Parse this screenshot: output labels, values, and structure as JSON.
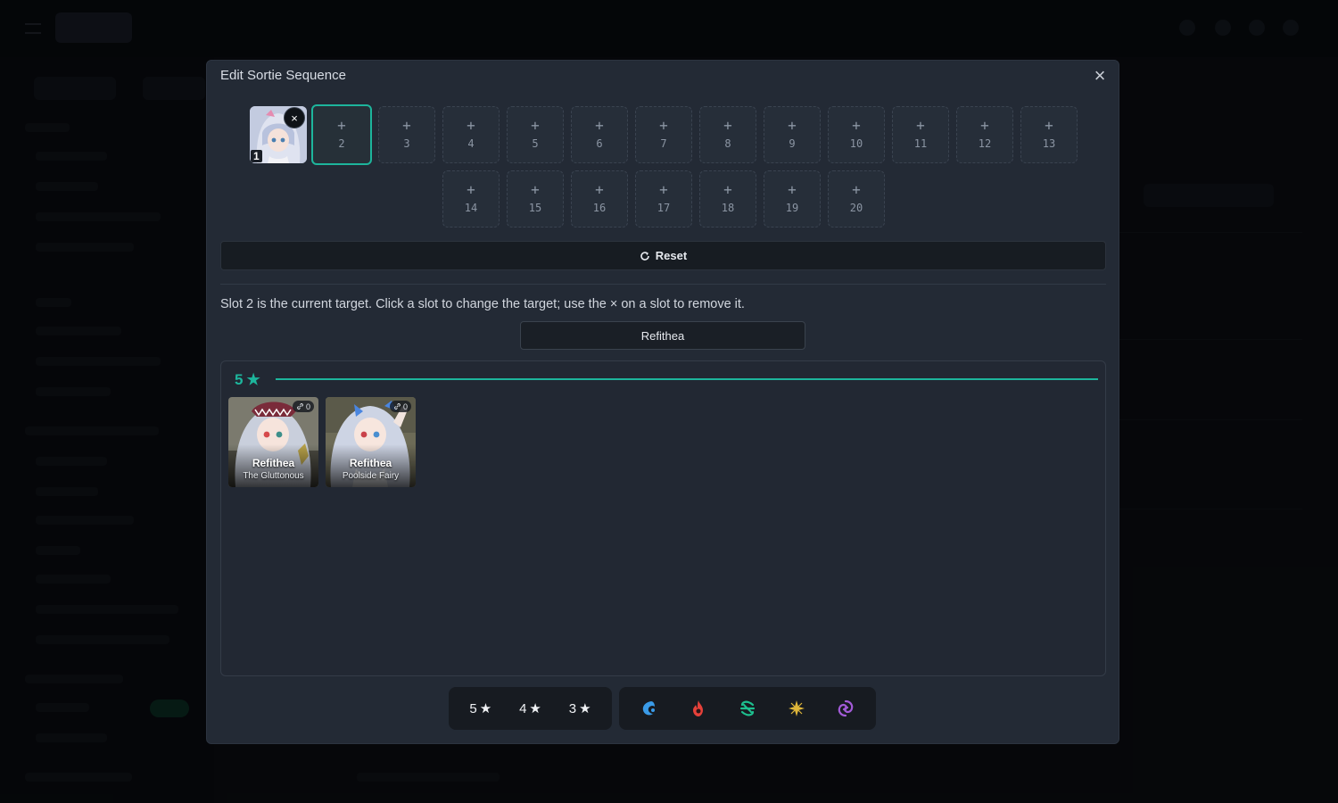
{
  "modal": {
    "title": "Edit Sortie Sequence",
    "close_label": "×",
    "filled_slot": {
      "number": "1",
      "remove_label": "×"
    },
    "slots": [
      "2",
      "3",
      "4",
      "5",
      "6",
      "7",
      "8",
      "9",
      "10",
      "11",
      "12",
      "13",
      "14",
      "15",
      "16",
      "17",
      "18",
      "19",
      "20"
    ],
    "active_slot": "2",
    "reset_label": "Reset",
    "hint": "Slot 2 is the current target. Click a slot to change the target; use the × on a slot to remove it.",
    "search_value": "Refithea",
    "group_label": "5",
    "cards": [
      {
        "name": "Refithea",
        "subtitle": "The Gluttonous",
        "link_count": "0"
      },
      {
        "name": "Refithea",
        "subtitle": "Poolside Fairy",
        "link_count": "0"
      }
    ],
    "rarity_filters": [
      "5",
      "4",
      "3"
    ],
    "element_filters": [
      "water-icon",
      "fire-icon",
      "wind-icon",
      "light-icon",
      "dark-icon"
    ],
    "colors": {
      "accent": "#1db59c",
      "water": "#3a9be8",
      "fire": "#e5413a",
      "wind": "#1dbf8e",
      "light": "#e0b73a",
      "dark": "#a35bd8"
    }
  }
}
